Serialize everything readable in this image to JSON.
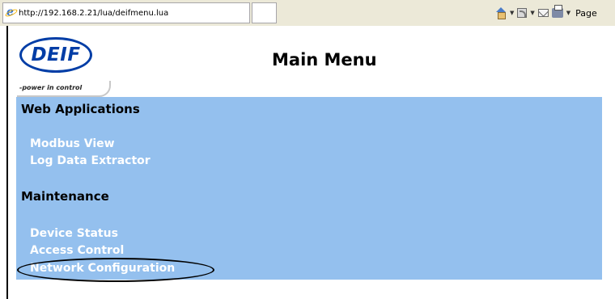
{
  "browser": {
    "url": "http://192.168.2.21/lua/deifmenu.lua",
    "page_menu_label": "Page"
  },
  "header": {
    "logo_text": "DEIF",
    "logo_tagline": "-power in control",
    "title": "Main Menu"
  },
  "sections": [
    {
      "title": "Web Applications",
      "links": [
        "Modbus View",
        "Log Data Extractor"
      ]
    },
    {
      "title": "Maintenance",
      "links": [
        "Device Status",
        "Access Control",
        "Network Configuration"
      ]
    }
  ],
  "highlighted_link": "Network Configuration",
  "colors": {
    "menu_panel_bg": "#94c0ee",
    "link_text": "#ffffff",
    "logo_blue": "#003da6"
  }
}
